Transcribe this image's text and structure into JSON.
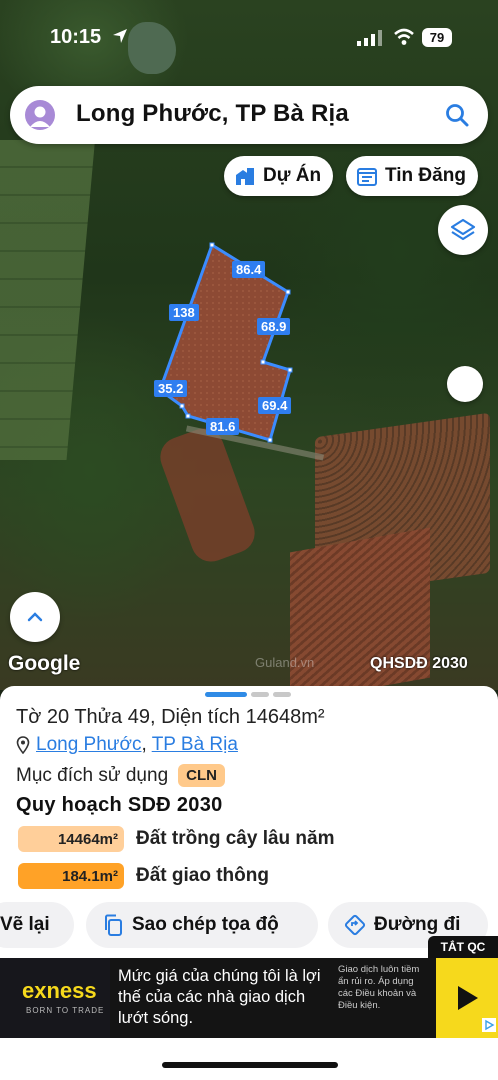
{
  "status_bar": {
    "time": "10:15",
    "battery": "79"
  },
  "search": {
    "title": "Long Phước, TP Bà Rịa"
  },
  "map_buttons": {
    "du_an": "Dự Án",
    "tin_dang": "Tin Đăng"
  },
  "parcel": {
    "edges": [
      "86.4",
      "138",
      "68.9",
      "35.2",
      "69.4",
      "81.6"
    ]
  },
  "map_footer": {
    "google": "Google",
    "watermark": "Guland.vn",
    "plan_label": "QHSDĐ 2030"
  },
  "sheet": {
    "title": "Tờ 20 Thửa 49, Diện tích 14648m²",
    "address": {
      "ward": "Long Phước",
      "separator": ", ",
      "city": "TP Bà Rịa"
    },
    "purpose_label": "Mục đích sử dụng",
    "purpose_code": "CLN",
    "plan_title": "Quy hoạch SDĐ 2030",
    "land_uses": [
      {
        "area": "14464m²",
        "label": "Đất trồng cây lâu năm",
        "color": "#ffcf9a"
      },
      {
        "area": "184.1m²",
        "label": "Đất giao thông",
        "color": "#ffa227"
      }
    ]
  },
  "actions": {
    "redraw": "Vẽ lại",
    "copy": "Sao chép tọa độ",
    "directions": "Đường đi"
  },
  "ad": {
    "tag": "TẮT QC",
    "brand": "exness",
    "brand_sub": "BORN TO TRADE",
    "headline": "Mức giá của chúng tôi là lợi thế của các nhà giao dịch lướt sóng.",
    "disclaimer": "Giao dịch luôn tiềm ẩn rủi ro. Áp dụng các Điều khoản và Điều kiện."
  },
  "colors": {
    "accent": "#2f7ef0",
    "link": "#2a7de1",
    "badge": "#ffc98a"
  }
}
